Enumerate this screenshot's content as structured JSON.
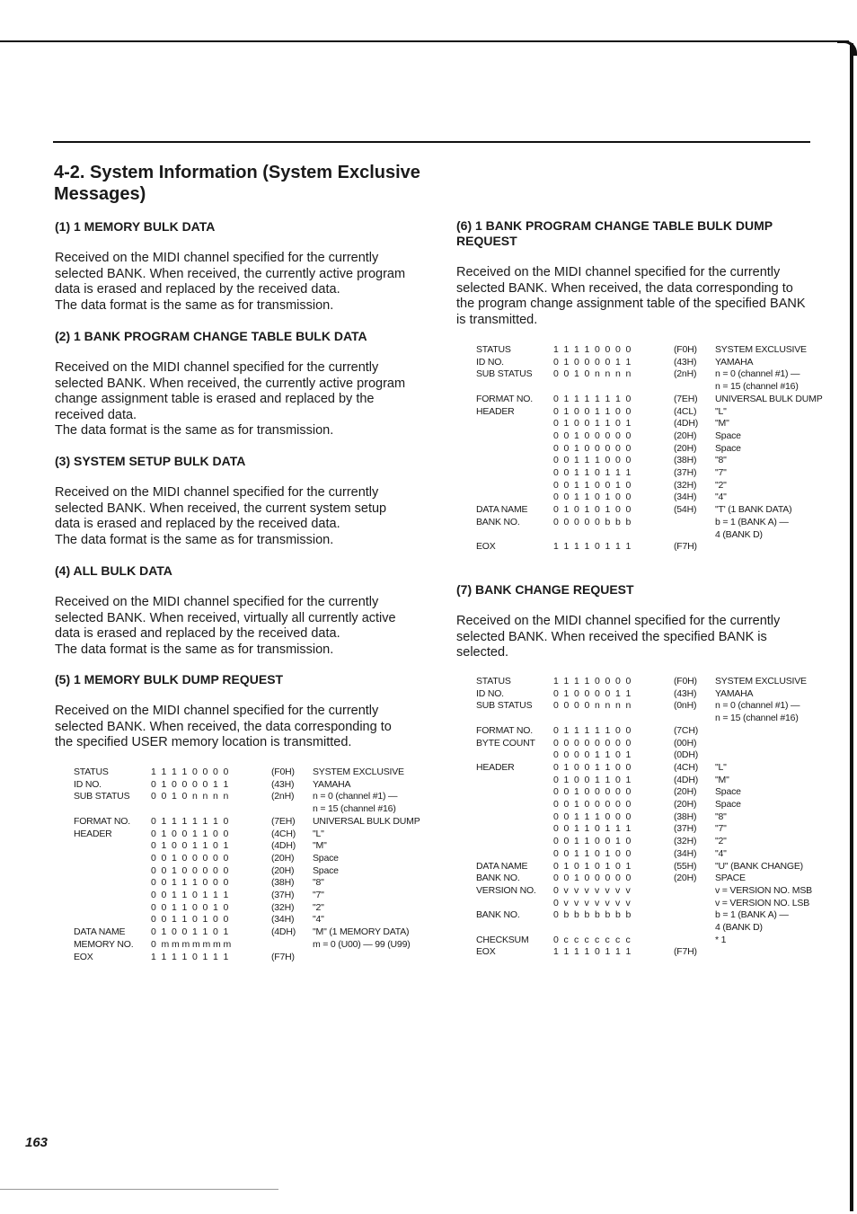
{
  "page": {
    "title": "4-2. System Information (System Exclusive Messages)",
    "page_number": "163"
  },
  "sections": {
    "s1": {
      "heading": "(1) 1 MEMORY BULK DATA",
      "body": "Received on the MIDI channel specified for the currently\nselected BANK. When received, the currently active program\ndata is erased and replaced by the received data.\nThe data format is the same as for transmission."
    },
    "s2": {
      "heading": "(2) 1 BANK PROGRAM CHANGE TABLE BULK DATA",
      "body": "Received on the MIDI channel specified for the currently\nselected BANK. When received, the currently active program\nchange assignment table is erased and replaced by the\nreceived data.\nThe data format is the same as for transmission."
    },
    "s3": {
      "heading": "(3) SYSTEM SETUP BULK DATA",
      "body": "Received on the MIDI channel specified for the currently\nselected BANK. When received, the current system setup\ndata is erased and replaced by the received data.\nThe data format is the same as for transmission."
    },
    "s4": {
      "heading": "(4) ALL BULK DATA",
      "body": "Received on the MIDI channel specified for the currently\nselected BANK. When received, virtually all currently active\ndata is erased and replaced by the received data.\nThe data format is the same as for transmission."
    },
    "s5": {
      "heading": "(5) 1 MEMORY BULK DUMP REQUEST",
      "body": "Received on the MIDI channel specified for the currently\nselected BANK. When received, the data corresponding to\nthe specified USER memory location is transmitted.",
      "table": [
        {
          "label": "STATUS",
          "bits": [
            "1",
            "1",
            "1",
            "1",
            "0",
            "0",
            "0",
            "0"
          ],
          "hex": "(F0H)",
          "desc": "SYSTEM EXCLUSIVE"
        },
        {
          "label": "ID NO.",
          "bits": [
            "0",
            "1",
            "0",
            "0",
            "0",
            "0",
            "1",
            "1"
          ],
          "hex": "(43H)",
          "desc": "YAMAHA"
        },
        {
          "label": "SUB STATUS",
          "bits": [
            "0",
            "0",
            "1",
            "0",
            "n",
            "n",
            "n",
            "n"
          ],
          "hex": "(2nH)",
          "desc": "n = 0  (channel #1) —"
        },
        {
          "label": "",
          "bits": [],
          "hex": "",
          "desc": "   n = 15  (channel #16)"
        },
        {
          "label": "FORMAT NO.",
          "bits": [
            "0",
            "1",
            "1",
            "1",
            "1",
            "1",
            "1",
            "0"
          ],
          "hex": "(7EH)",
          "desc": "UNIVERSAL BULK DUMP"
        },
        {
          "label": "HEADER",
          "bits": [
            "0",
            "1",
            "0",
            "0",
            "1",
            "1",
            "0",
            "0"
          ],
          "hex": "(4CH)",
          "desc": "\"L\""
        },
        {
          "label": "",
          "bits": [
            "0",
            "1",
            "0",
            "0",
            "1",
            "1",
            "0",
            "1"
          ],
          "hex": "(4DH)",
          "desc": "\"M\""
        },
        {
          "label": "",
          "bits": [
            "0",
            "0",
            "1",
            "0",
            "0",
            "0",
            "0",
            "0"
          ],
          "hex": "(20H)",
          "desc": "Space"
        },
        {
          "label": "",
          "bits": [
            "0",
            "0",
            "1",
            "0",
            "0",
            "0",
            "0",
            "0"
          ],
          "hex": "(20H)",
          "desc": "Space"
        },
        {
          "label": "",
          "bits": [
            "0",
            "0",
            "1",
            "1",
            "1",
            "0",
            "0",
            "0"
          ],
          "hex": "(38H)",
          "desc": "\"8\""
        },
        {
          "label": "",
          "bits": [
            "0",
            "0",
            "1",
            "1",
            "0",
            "1",
            "1",
            "1"
          ],
          "hex": "(37H)",
          "desc": "\"7\""
        },
        {
          "label": "",
          "bits": [
            "0",
            "0",
            "1",
            "1",
            "0",
            "0",
            "1",
            "0"
          ],
          "hex": "(32H)",
          "desc": "\"2\""
        },
        {
          "label": "",
          "bits": [
            "0",
            "0",
            "1",
            "1",
            "0",
            "1",
            "0",
            "0"
          ],
          "hex": "(34H)",
          "desc": "\"4\""
        },
        {
          "label": "DATA NAME",
          "bits": [
            "0",
            "1",
            "0",
            "0",
            "1",
            "1",
            "0",
            "1"
          ],
          "hex": "(4DH)",
          "desc": "\"M\" (1 MEMORY DATA)"
        },
        {
          "label": "MEMORY NO.",
          "bits": [
            "0",
            "m",
            "m",
            "m",
            "m",
            "m",
            "m",
            "m"
          ],
          "hex": "",
          "desc": "m = 0 (U00) — 99 (U99)"
        },
        {
          "label": "EOX",
          "bits": [
            "1",
            "1",
            "1",
            "1",
            "0",
            "1",
            "1",
            "1"
          ],
          "hex": "(F7H)",
          "desc": ""
        }
      ]
    },
    "s6": {
      "heading": "(6) 1 BANK PROGRAM CHANGE TABLE BULK DUMP\nREQUEST",
      "body": "Received on the MIDI channel specified for the currently\nselected BANK. When received, the data corresponding to\nthe program change assignment table of the specified BANK\nis transmitted.",
      "table": [
        {
          "label": "STATUS",
          "bits": [
            "1",
            "1",
            "1",
            "1",
            "0",
            "0",
            "0",
            "0"
          ],
          "hex": "(F0H)",
          "desc": "SYSTEM EXCLUSIVE"
        },
        {
          "label": "ID NO.",
          "bits": [
            "0",
            "1",
            "0",
            "0",
            "0",
            "0",
            "1",
            "1"
          ],
          "hex": "(43H)",
          "desc": "YAMAHA"
        },
        {
          "label": "SUB STATUS",
          "bits": [
            "0",
            "0",
            "1",
            "0",
            "n",
            "n",
            "n",
            "n"
          ],
          "hex": "(2nH)",
          "desc": "n = 0  (channel #1) —"
        },
        {
          "label": "",
          "bits": [],
          "hex": "",
          "desc": "   n = 15  (channel #16)"
        },
        {
          "label": "FORMAT NO.",
          "bits": [
            "0",
            "1",
            "1",
            "1",
            "1",
            "1",
            "1",
            "0"
          ],
          "hex": "(7EH)",
          "desc": "UNIVERSAL BULK DUMP"
        },
        {
          "label": "HEADER",
          "bits": [
            "0",
            "1",
            "0",
            "0",
            "1",
            "1",
            "0",
            "0"
          ],
          "hex": "(4CL)",
          "desc": "\"L\""
        },
        {
          "label": "",
          "bits": [
            "0",
            "1",
            "0",
            "0",
            "1",
            "1",
            "0",
            "1"
          ],
          "hex": "(4DH)",
          "desc": "\"M\""
        },
        {
          "label": "",
          "bits": [
            "0",
            "0",
            "1",
            "0",
            "0",
            "0",
            "0",
            "0"
          ],
          "hex": "(20H)",
          "desc": "Space"
        },
        {
          "label": "",
          "bits": [
            "0",
            "0",
            "1",
            "0",
            "0",
            "0",
            "0",
            "0"
          ],
          "hex": "(20H)",
          "desc": "Space"
        },
        {
          "label": "",
          "bits": [
            "0",
            "0",
            "1",
            "1",
            "1",
            "0",
            "0",
            "0"
          ],
          "hex": "(38H)",
          "desc": "\"8\""
        },
        {
          "label": "",
          "bits": [
            "0",
            "0",
            "1",
            "1",
            "0",
            "1",
            "1",
            "1"
          ],
          "hex": "(37H)",
          "desc": "\"7\""
        },
        {
          "label": "",
          "bits": [
            "0",
            "0",
            "1",
            "1",
            "0",
            "0",
            "1",
            "0"
          ],
          "hex": "(32H)",
          "desc": "\"2\""
        },
        {
          "label": "",
          "bits": [
            "0",
            "0",
            "1",
            "1",
            "0",
            "1",
            "0",
            "0"
          ],
          "hex": "(34H)",
          "desc": "\"4\""
        },
        {
          "label": "DATA NAME",
          "bits": [
            "0",
            "1",
            "0",
            "1",
            "0",
            "1",
            "0",
            "0"
          ],
          "hex": "(54H)",
          "desc": "\"T' (1 BANK DATA)"
        },
        {
          "label": "BANK NO.",
          "bits": [
            "0",
            "0",
            "0",
            "0",
            "0",
            "b",
            "b",
            "b"
          ],
          "hex": "",
          "desc": "b = 1  (BANK A) —"
        },
        {
          "label": "",
          "bits": [],
          "hex": "",
          "desc": "  4 (BANK D)"
        },
        {
          "label": "EOX",
          "bits": [
            "1",
            "1",
            "1",
            "1",
            "0",
            "1",
            "1",
            "1"
          ],
          "hex": "(F7H)",
          "desc": ""
        }
      ]
    },
    "s7": {
      "heading": "(7) BANK CHANGE REQUEST",
      "body": "Received on the MIDI channel specified for the currently\nselected BANK. When received the specified BANK is\nselected.",
      "table": [
        {
          "label": "STATUS",
          "bits": [
            "1",
            "1",
            "1",
            "1",
            "0",
            "0",
            "0",
            "0"
          ],
          "hex": "(F0H)",
          "desc": "SYSTEM EXCLUSIVE"
        },
        {
          "label": "ID NO.",
          "bits": [
            "0",
            "1",
            "0",
            "0",
            "0",
            "0",
            "1",
            "1"
          ],
          "hex": "(43H)",
          "desc": "YAMAHA"
        },
        {
          "label": "SUB STATUS",
          "bits": [
            "0",
            "0",
            "0",
            "0",
            "n",
            "n",
            "n",
            "n"
          ],
          "hex": "(0nH)",
          "desc": "n = 0  (channel #1) —"
        },
        {
          "label": "",
          "bits": [],
          "hex": "",
          "desc": "   n = 15  (channel #16)"
        },
        {
          "label": "FORMAT NO.",
          "bits": [
            "0",
            "1",
            "1",
            "1",
            "1",
            "1",
            "0",
            "0"
          ],
          "hex": "(7CH)",
          "desc": ""
        },
        {
          "label": "BYTE COUNT",
          "bits": [
            "0",
            "0",
            "0",
            "0",
            "0",
            "0",
            "0",
            "0"
          ],
          "hex": "(00H)",
          "desc": ""
        },
        {
          "label": "",
          "bits": [
            "0",
            "0",
            "0",
            "0",
            "1",
            "1",
            "0",
            "1"
          ],
          "hex": "(0DH)",
          "desc": ""
        },
        {
          "label": "HEADER",
          "bits": [
            "0",
            "1",
            "0",
            "0",
            "1",
            "1",
            "0",
            "0"
          ],
          "hex": "(4CH)",
          "desc": "\"L\""
        },
        {
          "label": "",
          "bits": [
            "0",
            "1",
            "0",
            "0",
            "1",
            "1",
            "0",
            "1"
          ],
          "hex": "(4DH)",
          "desc": "\"M\""
        },
        {
          "label": "",
          "bits": [
            "0",
            "0",
            "1",
            "0",
            "0",
            "0",
            "0",
            "0"
          ],
          "hex": "(20H)",
          "desc": "Space"
        },
        {
          "label": "",
          "bits": [
            "0",
            "0",
            "1",
            "0",
            "0",
            "0",
            "0",
            "0"
          ],
          "hex": "(20H)",
          "desc": "Space"
        },
        {
          "label": "",
          "bits": [
            "0",
            "0",
            "1",
            "1",
            "1",
            "0",
            "0",
            "0"
          ],
          "hex": "(38H)",
          "desc": "\"8\""
        },
        {
          "label": "",
          "bits": [
            "0",
            "0",
            "1",
            "1",
            "0",
            "1",
            "1",
            "1"
          ],
          "hex": "(37H)",
          "desc": "\"7\""
        },
        {
          "label": "",
          "bits": [
            "0",
            "0",
            "1",
            "1",
            "0",
            "0",
            "1",
            "0"
          ],
          "hex": "(32H)",
          "desc": "\"2\""
        },
        {
          "label": "",
          "bits": [
            "0",
            "0",
            "1",
            "1",
            "0",
            "1",
            "0",
            "0"
          ],
          "hex": "(34H)",
          "desc": "\"4\""
        },
        {
          "label": "DATA NAME",
          "bits": [
            "0",
            "1",
            "0",
            "1",
            "0",
            "1",
            "0",
            "1"
          ],
          "hex": "(55H)",
          "desc": "\"U\" (BANK CHANGE)"
        },
        {
          "label": "BANK NO.",
          "bits": [
            "0",
            "0",
            "1",
            "0",
            "0",
            "0",
            "0",
            "0"
          ],
          "hex": "(20H)",
          "desc": "SPACE"
        },
        {
          "label": "VERSION NO.",
          "bits": [
            "0",
            "v",
            "v",
            "v",
            "v",
            "v",
            "v",
            "v"
          ],
          "hex": "",
          "desc": "v = VERSION NO. MSB"
        },
        {
          "label": "",
          "bits": [
            "0",
            "v",
            "v",
            "v",
            "v",
            "v",
            "v",
            "v"
          ],
          "hex": "",
          "desc": "v = VERSION NO. LSB"
        },
        {
          "label": "BANK NO.",
          "bits": [
            "0",
            "b",
            "b",
            "b",
            "b",
            "b",
            "b",
            "b"
          ],
          "hex": "",
          "desc": "b = 1  (BANK A) —"
        },
        {
          "label": "",
          "bits": [],
          "hex": "",
          "desc": "  4 (BANK D)"
        },
        {
          "label": "CHECKSUM",
          "bits": [
            "0",
            "c",
            "c",
            "c",
            "c",
            "c",
            "c",
            "c"
          ],
          "hex": "",
          "desc": "* 1"
        },
        {
          "label": "EOX",
          "bits": [
            "1",
            "1",
            "1",
            "1",
            "0",
            "1",
            "1",
            "1"
          ],
          "hex": "(F7H)",
          "desc": ""
        }
      ]
    }
  }
}
